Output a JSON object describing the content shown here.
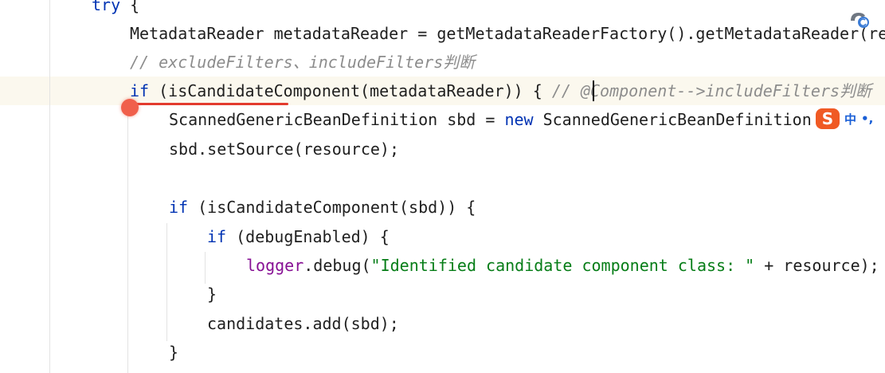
{
  "editor": {
    "lines": [
      {
        "id": "l0",
        "tokens": [
          {
            "t": "try {",
            "c": "kw-mixed",
            "kw": "try",
            "rest": " {"
          }
        ]
      },
      {
        "id": "l1",
        "text": "MetadataReader metadataReader = getMetadataReaderFactory().getMetadataReader(re"
      },
      {
        "id": "l2",
        "comment": "// excludeFilters、includeFilters判断"
      },
      {
        "id": "l3",
        "kw": "if",
        "code": " (isCandidateComponent(metadataReader)) { ",
        "comment": "// @Component-->includeFilters判断"
      },
      {
        "id": "l4",
        "pre": "ScannedGenericBeanDefinition sbd = ",
        "kw": "new",
        "post": " ScannedGenericBeanDefinition"
      },
      {
        "id": "l5",
        "text": "sbd.setSource(resource);"
      },
      {
        "id": "l6",
        "kw": "if",
        "code": " (isCandidateComponent(sbd)) {"
      },
      {
        "id": "l7",
        "kw": "if",
        "code": " (debugEnabled) {"
      },
      {
        "id": "l8",
        "field": "logger",
        "mid": ".debug(",
        "str": "\"Identified candidate component class: \"",
        "post": " + resource);"
      },
      {
        "id": "l9",
        "text": "}"
      },
      {
        "id": "l10",
        "text": "candidates.add(sbd);"
      },
      {
        "id": "l11",
        "text": "}"
      }
    ]
  },
  "ime": {
    "logo": "S",
    "language": "中",
    "punctuation": "•,"
  },
  "icons": {
    "breakpoint": "breakpoint-icon",
    "assistant": "ai-assistant-icon"
  },
  "colors": {
    "keyword": "#0033b3",
    "comment": "#8c8c8c",
    "string": "#067d17",
    "field": "#871094",
    "breakpoint": "#f05f4b",
    "underline": "#e33b2e",
    "ime_logo": "#f05a24"
  }
}
